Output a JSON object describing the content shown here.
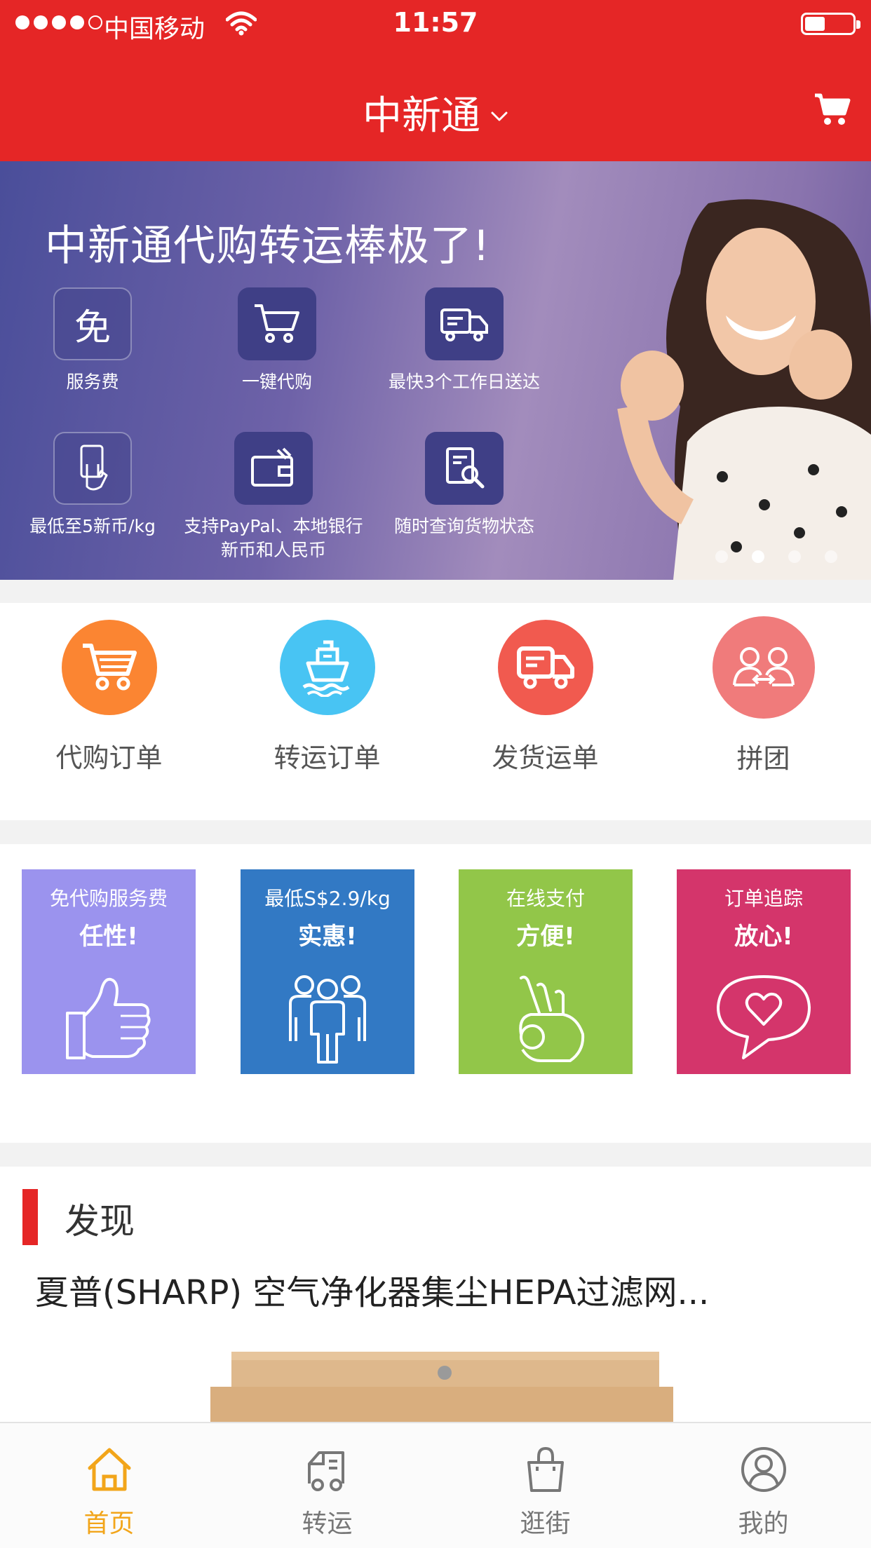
{
  "status_bar": {
    "carrier": "中国移动",
    "time": "11:57",
    "battery_level": 0.35
  },
  "header": {
    "title": "中新通",
    "cart_icon": "cart-icon",
    "background_color": "#e52626"
  },
  "banner": {
    "headline": "中新通代购转运棒极了!",
    "features": [
      {
        "icon_text": "免",
        "icon": "free-icon",
        "label": "服务费"
      },
      {
        "icon": "cart-icon",
        "label": "一键代购"
      },
      {
        "icon": "truck-icon",
        "label": "最快3个工作日送达"
      },
      {
        "icon": "hand-card-icon",
        "label": "最低至5新币/kg"
      },
      {
        "icon": "wallet-icon",
        "label": "支持PayPal、本地银行",
        "label2": "新币和人民币"
      },
      {
        "icon": "search-document-icon",
        "label": "随时查询货物状态"
      }
    ],
    "active_slide": 2,
    "slide_count": 4
  },
  "quick_nav": [
    {
      "label": "代购订单",
      "icon": "cart-icon",
      "color": "#fb8532"
    },
    {
      "label": "转运订单",
      "icon": "ship-icon",
      "color": "#48c4f3"
    },
    {
      "label": "发货运单",
      "icon": "truck-icon",
      "color": "#f15a4f"
    },
    {
      "label": "拼团",
      "icon": "group-icon",
      "color": "#f07b7b"
    }
  ],
  "promos": [
    {
      "line1": "免代购服务费",
      "line2": "任性!",
      "icon": "thumbs-up-icon",
      "color": "#9b93ee"
    },
    {
      "line1": "最低S$2.9/kg",
      "line2": "实惠!",
      "icon": "people-icon",
      "color": "#3279c4"
    },
    {
      "line1": "在线支付",
      "line2": "方便!",
      "icon": "ok-hand-icon",
      "color": "#92c649"
    },
    {
      "line1": "订单追踪",
      "line2": "放心!",
      "icon": "heart-chat-icon",
      "color": "#d4356b"
    }
  ],
  "discover": {
    "title": "发现",
    "product_title": "夏普(SHARP) 空气净化器集尘HEPA过滤网..."
  },
  "tabbar": {
    "items": [
      {
        "label": "首页",
        "icon": "home-icon",
        "active": true
      },
      {
        "label": "转运",
        "icon": "delivery-truck-icon",
        "active": false
      },
      {
        "label": "逛街",
        "icon": "shopping-bag-icon",
        "active": false
      },
      {
        "label": "我的",
        "icon": "user-icon",
        "active": false
      }
    ],
    "active_color": "#f2a51a"
  }
}
